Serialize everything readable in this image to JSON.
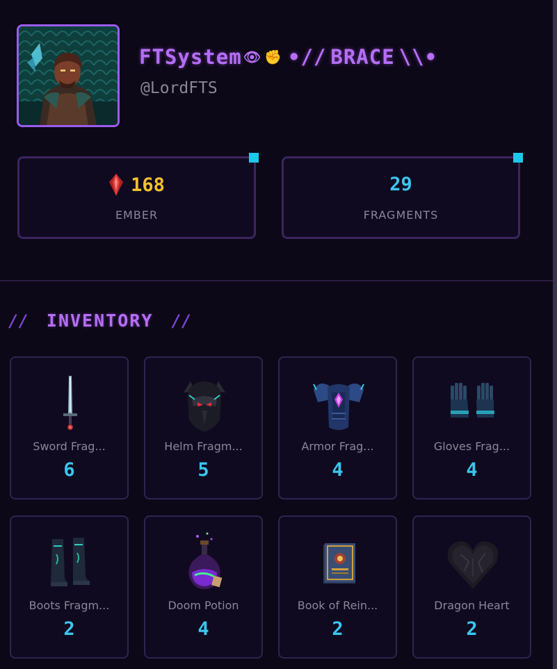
{
  "profile": {
    "display_name": "FTSystem",
    "name_glyphs": [
      "👁",
      "✊"
    ],
    "name_decoration_left": "•//",
    "name_tag": "BRACE",
    "name_decoration_right": "\\\\•",
    "handle": "@LordFTS",
    "avatar_icon": "hooded-warrior-portrait"
  },
  "stats": {
    "ember": {
      "value": "168",
      "label": "EMBER",
      "icon": "ember-crystal-icon"
    },
    "fragments": {
      "value": "29",
      "label": "FRAGMENTS"
    }
  },
  "inventory": {
    "title": "INVENTORY",
    "slash_left": "//",
    "slash_right": "//",
    "items": [
      {
        "name": "Sword Frag...",
        "qty": "6",
        "icon": "sword-icon"
      },
      {
        "name": "Helm Fragm...",
        "qty": "5",
        "icon": "helm-icon"
      },
      {
        "name": "Armor Frag...",
        "qty": "4",
        "icon": "armor-icon"
      },
      {
        "name": "Gloves Frag...",
        "qty": "4",
        "icon": "gloves-icon"
      },
      {
        "name": "Boots Fragm...",
        "qty": "2",
        "icon": "boots-icon"
      },
      {
        "name": "Doom Potion",
        "qty": "4",
        "icon": "potion-icon"
      },
      {
        "name": "Book of Rein...",
        "qty": "2",
        "icon": "book-icon"
      },
      {
        "name": "Dragon Heart",
        "qty": "2",
        "icon": "heart-icon"
      }
    ]
  },
  "colors": {
    "background": "#0c0817",
    "accent_purple": "#b56ef5",
    "accent_cyan": "#39c6ee",
    "ember_gold": "#f2c12e",
    "card_border": "#3b2560"
  }
}
